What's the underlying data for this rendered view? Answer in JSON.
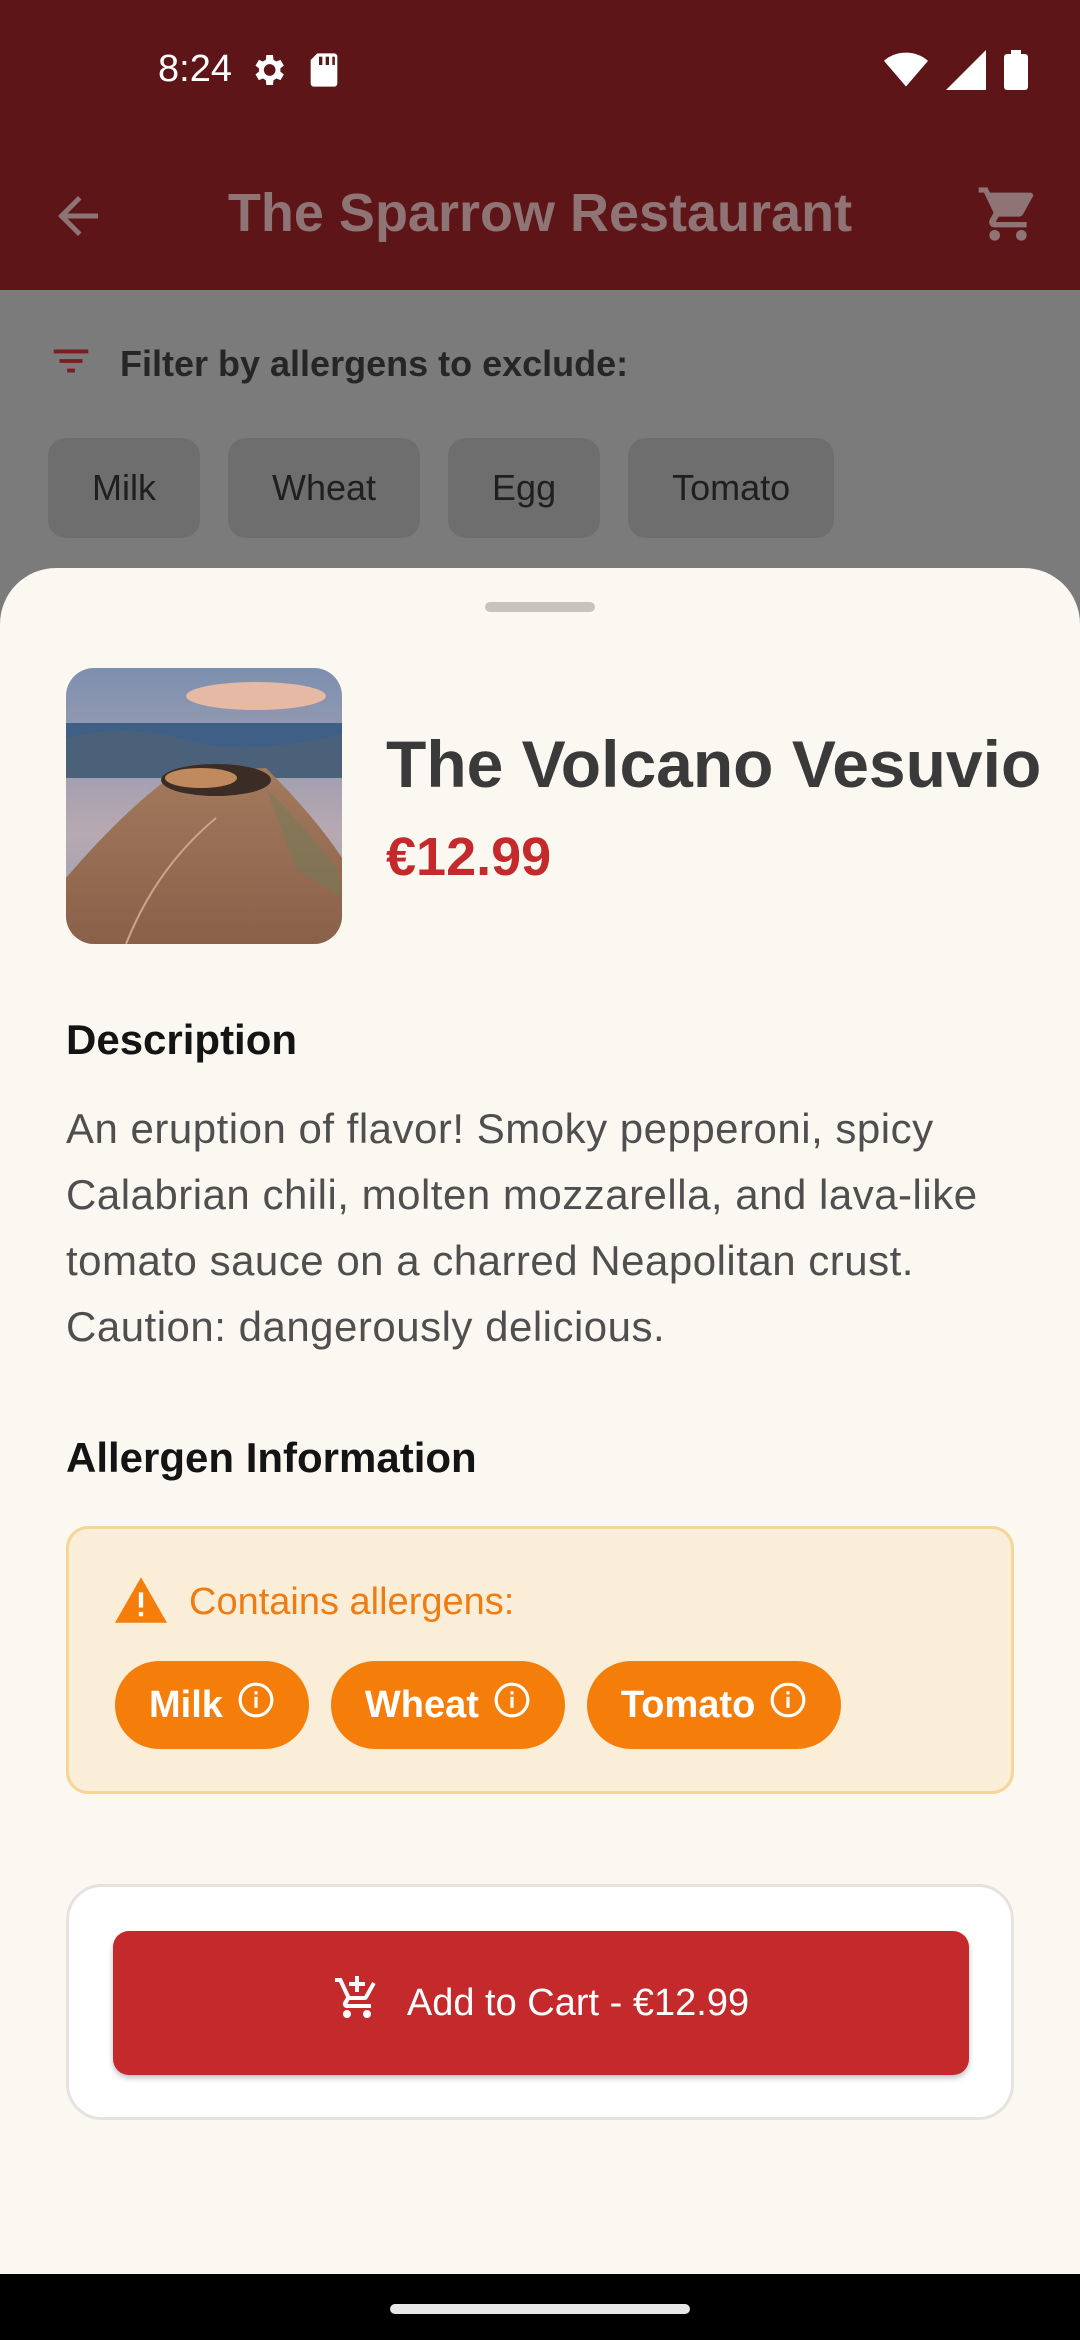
{
  "status_bar": {
    "time": "8:24",
    "icons_left": [
      "settings-icon",
      "sd-card-icon"
    ],
    "icons_right": [
      "wifi-icon",
      "cell-signal-icon",
      "battery-icon"
    ]
  },
  "app_bar": {
    "title": "The Sparrow Restaurant",
    "back_icon": "arrow-back-icon",
    "cart_icon": "shopping-cart-icon"
  },
  "filter": {
    "label": "Filter by allergens to exclude:",
    "chips": [
      "Milk",
      "Wheat",
      "Egg",
      "Tomato"
    ]
  },
  "item": {
    "name": "The Volcano Vesuvio",
    "price": "€12.99",
    "description_heading": "Description",
    "description": "An eruption of flavor! Smoky pepperoni, spicy Calabrian chili, molten mozzarella, and lava-like tomato sauce on a charred Neapolitan crust. Caution: dangerously delicious.",
    "allergen_heading": "Allergen Information",
    "allergen_warning": "Contains allergens:",
    "allergens": [
      "Milk",
      "Wheat",
      "Tomato"
    ]
  },
  "cart_button": {
    "label": "Add to Cart - €12.99",
    "icon": "add-shopping-cart-icon"
  },
  "colors": {
    "app_bar": "#5e1517",
    "price": "#c42a2c",
    "warning": "#f57d0a",
    "button": "#c42a2c",
    "sheet": "#fbf7f1"
  }
}
